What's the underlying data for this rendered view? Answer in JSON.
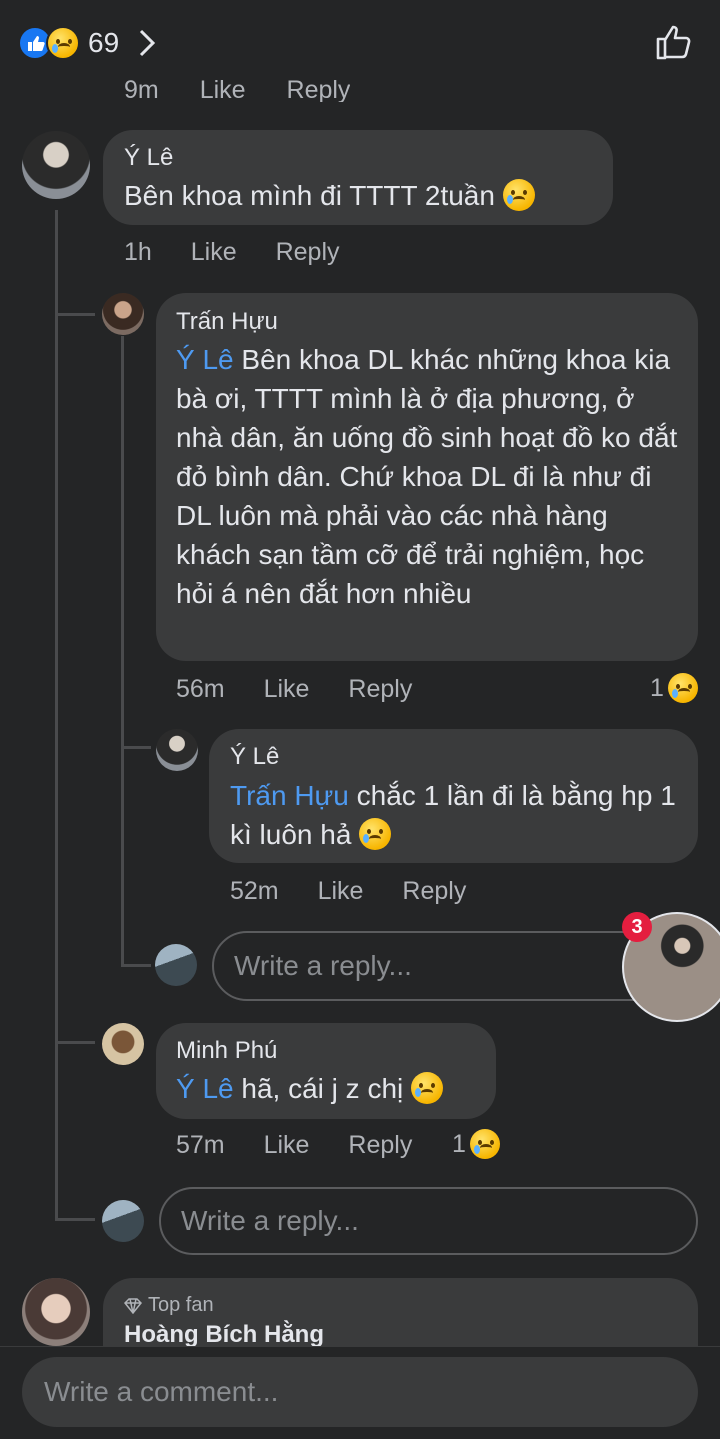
{
  "header": {
    "reaction_count": "69",
    "reactions": [
      "like-icon",
      "sad-icon"
    ],
    "chevron": "chevron-right-icon",
    "like_button": "thumbs-up-icon"
  },
  "top_meta": {
    "time": "9m",
    "like": "Like",
    "reply": "Reply"
  },
  "comment1": {
    "author": "Ý Lê",
    "text": "Bên khoa mình đi TTTT 2tuần",
    "time": "1h",
    "like": "Like",
    "reply": "Reply"
  },
  "reply1": {
    "author": "Trấn Hựu",
    "mention": "Ý Lê",
    "text": " Bên khoa DL khác những khoa kia bà ơi, TTTT mình là ở địa phương, ở nhà dân, ăn uống đồ sinh hoạt đồ ko đắt đỏ bình dân. Chứ khoa DL đi là như đi DL luôn mà phải vào các nhà hàng khách sạn tầm cỡ để trải nghiệm, học hỏi á nên đắt hơn nhiều",
    "time": "56m",
    "like": "Like",
    "reply": "Reply",
    "reaction_count": "1"
  },
  "reply2": {
    "author": "Ý Lê",
    "mention": "Trấn Hựu",
    "text": " chắc 1 lần đi là bằng hp 1 kì luôn hả",
    "time": "52m",
    "like": "Like",
    "reply": "Reply"
  },
  "reply_box_inner": {
    "placeholder": "Write a reply..."
  },
  "chat_head": {
    "badge": "3"
  },
  "reply3": {
    "author": "Minh Phú",
    "mention": "Ý Lê",
    "text": " hã, cái j z chị",
    "time": "57m",
    "like": "Like",
    "reply": "Reply",
    "reaction_count": "1"
  },
  "reply_box_outer": {
    "placeholder": "Write a reply..."
  },
  "comment2": {
    "badge": "Top fan",
    "author": "Hoàng Bích Hằng"
  },
  "comment_box": {
    "placeholder": "Write a comment..."
  }
}
